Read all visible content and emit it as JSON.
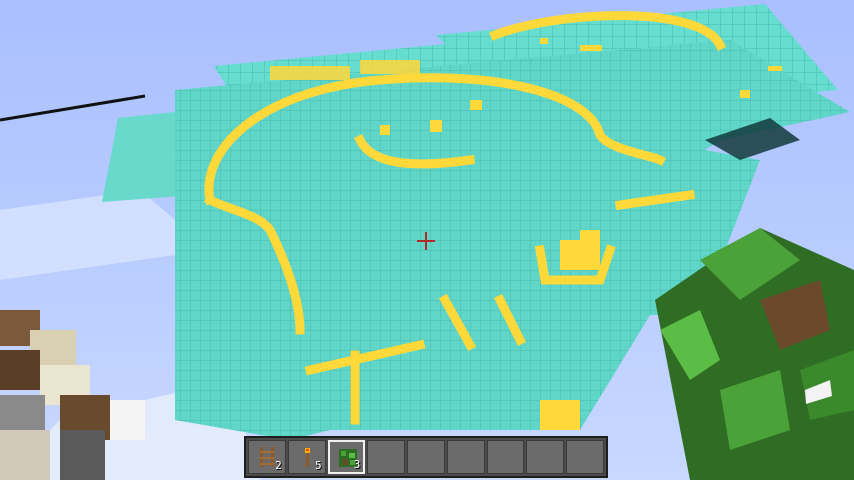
{
  "hud": {
    "crosshair": "crosshair-icon",
    "hotbar": {
      "selected_index": 2,
      "slots": [
        {
          "item": "ladder-icon",
          "count": "2"
        },
        {
          "item": "torch-icon",
          "count": "5"
        },
        {
          "item": "leaves-block-icon",
          "count": "3"
        },
        {
          "item": "empty",
          "count": ""
        },
        {
          "item": "empty",
          "count": ""
        },
        {
          "item": "empty",
          "count": ""
        },
        {
          "item": "empty",
          "count": ""
        },
        {
          "item": "empty",
          "count": ""
        },
        {
          "item": "empty",
          "count": ""
        }
      ]
    }
  },
  "world": {
    "sky_color": "#a9bfff",
    "board_color": "#5fd6c8",
    "board_grid_color": "#4ab9ad",
    "paint_color": "#ffd83a",
    "leaves_color": "#3f8f2f"
  }
}
